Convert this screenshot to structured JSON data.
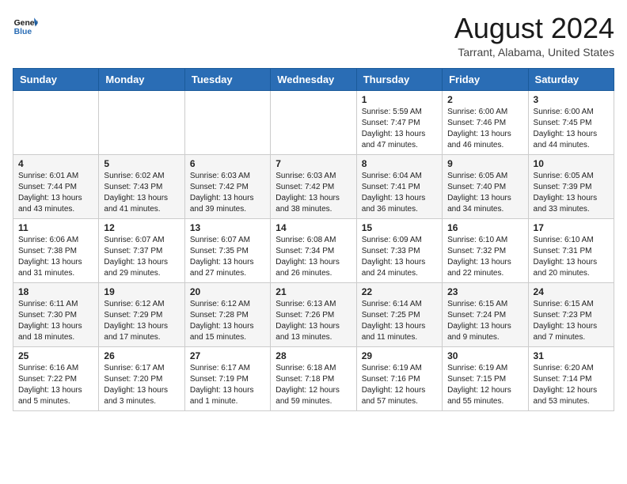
{
  "header": {
    "logo_line1": "General",
    "logo_line2": "Blue",
    "month_year": "August 2024",
    "location": "Tarrant, Alabama, United States"
  },
  "columns": [
    "Sunday",
    "Monday",
    "Tuesday",
    "Wednesday",
    "Thursday",
    "Friday",
    "Saturday"
  ],
  "weeks": [
    [
      {
        "day": "",
        "info": ""
      },
      {
        "day": "",
        "info": ""
      },
      {
        "day": "",
        "info": ""
      },
      {
        "day": "",
        "info": ""
      },
      {
        "day": "1",
        "info": "Sunrise: 5:59 AM\nSunset: 7:47 PM\nDaylight: 13 hours\nand 47 minutes."
      },
      {
        "day": "2",
        "info": "Sunrise: 6:00 AM\nSunset: 7:46 PM\nDaylight: 13 hours\nand 46 minutes."
      },
      {
        "day": "3",
        "info": "Sunrise: 6:00 AM\nSunset: 7:45 PM\nDaylight: 13 hours\nand 44 minutes."
      }
    ],
    [
      {
        "day": "4",
        "info": "Sunrise: 6:01 AM\nSunset: 7:44 PM\nDaylight: 13 hours\nand 43 minutes."
      },
      {
        "day": "5",
        "info": "Sunrise: 6:02 AM\nSunset: 7:43 PM\nDaylight: 13 hours\nand 41 minutes."
      },
      {
        "day": "6",
        "info": "Sunrise: 6:03 AM\nSunset: 7:42 PM\nDaylight: 13 hours\nand 39 minutes."
      },
      {
        "day": "7",
        "info": "Sunrise: 6:03 AM\nSunset: 7:42 PM\nDaylight: 13 hours\nand 38 minutes."
      },
      {
        "day": "8",
        "info": "Sunrise: 6:04 AM\nSunset: 7:41 PM\nDaylight: 13 hours\nand 36 minutes."
      },
      {
        "day": "9",
        "info": "Sunrise: 6:05 AM\nSunset: 7:40 PM\nDaylight: 13 hours\nand 34 minutes."
      },
      {
        "day": "10",
        "info": "Sunrise: 6:05 AM\nSunset: 7:39 PM\nDaylight: 13 hours\nand 33 minutes."
      }
    ],
    [
      {
        "day": "11",
        "info": "Sunrise: 6:06 AM\nSunset: 7:38 PM\nDaylight: 13 hours\nand 31 minutes."
      },
      {
        "day": "12",
        "info": "Sunrise: 6:07 AM\nSunset: 7:37 PM\nDaylight: 13 hours\nand 29 minutes."
      },
      {
        "day": "13",
        "info": "Sunrise: 6:07 AM\nSunset: 7:35 PM\nDaylight: 13 hours\nand 27 minutes."
      },
      {
        "day": "14",
        "info": "Sunrise: 6:08 AM\nSunset: 7:34 PM\nDaylight: 13 hours\nand 26 minutes."
      },
      {
        "day": "15",
        "info": "Sunrise: 6:09 AM\nSunset: 7:33 PM\nDaylight: 13 hours\nand 24 minutes."
      },
      {
        "day": "16",
        "info": "Sunrise: 6:10 AM\nSunset: 7:32 PM\nDaylight: 13 hours\nand 22 minutes."
      },
      {
        "day": "17",
        "info": "Sunrise: 6:10 AM\nSunset: 7:31 PM\nDaylight: 13 hours\nand 20 minutes."
      }
    ],
    [
      {
        "day": "18",
        "info": "Sunrise: 6:11 AM\nSunset: 7:30 PM\nDaylight: 13 hours\nand 18 minutes."
      },
      {
        "day": "19",
        "info": "Sunrise: 6:12 AM\nSunset: 7:29 PM\nDaylight: 13 hours\nand 17 minutes."
      },
      {
        "day": "20",
        "info": "Sunrise: 6:12 AM\nSunset: 7:28 PM\nDaylight: 13 hours\nand 15 minutes."
      },
      {
        "day": "21",
        "info": "Sunrise: 6:13 AM\nSunset: 7:26 PM\nDaylight: 13 hours\nand 13 minutes."
      },
      {
        "day": "22",
        "info": "Sunrise: 6:14 AM\nSunset: 7:25 PM\nDaylight: 13 hours\nand 11 minutes."
      },
      {
        "day": "23",
        "info": "Sunrise: 6:15 AM\nSunset: 7:24 PM\nDaylight: 13 hours\nand 9 minutes."
      },
      {
        "day": "24",
        "info": "Sunrise: 6:15 AM\nSunset: 7:23 PM\nDaylight: 13 hours\nand 7 minutes."
      }
    ],
    [
      {
        "day": "25",
        "info": "Sunrise: 6:16 AM\nSunset: 7:22 PM\nDaylight: 13 hours\nand 5 minutes."
      },
      {
        "day": "26",
        "info": "Sunrise: 6:17 AM\nSunset: 7:20 PM\nDaylight: 13 hours\nand 3 minutes."
      },
      {
        "day": "27",
        "info": "Sunrise: 6:17 AM\nSunset: 7:19 PM\nDaylight: 13 hours\nand 1 minute."
      },
      {
        "day": "28",
        "info": "Sunrise: 6:18 AM\nSunset: 7:18 PM\nDaylight: 12 hours\nand 59 minutes."
      },
      {
        "day": "29",
        "info": "Sunrise: 6:19 AM\nSunset: 7:16 PM\nDaylight: 12 hours\nand 57 minutes."
      },
      {
        "day": "30",
        "info": "Sunrise: 6:19 AM\nSunset: 7:15 PM\nDaylight: 12 hours\nand 55 minutes."
      },
      {
        "day": "31",
        "info": "Sunrise: 6:20 AM\nSunset: 7:14 PM\nDaylight: 12 hours\nand 53 minutes."
      }
    ]
  ]
}
